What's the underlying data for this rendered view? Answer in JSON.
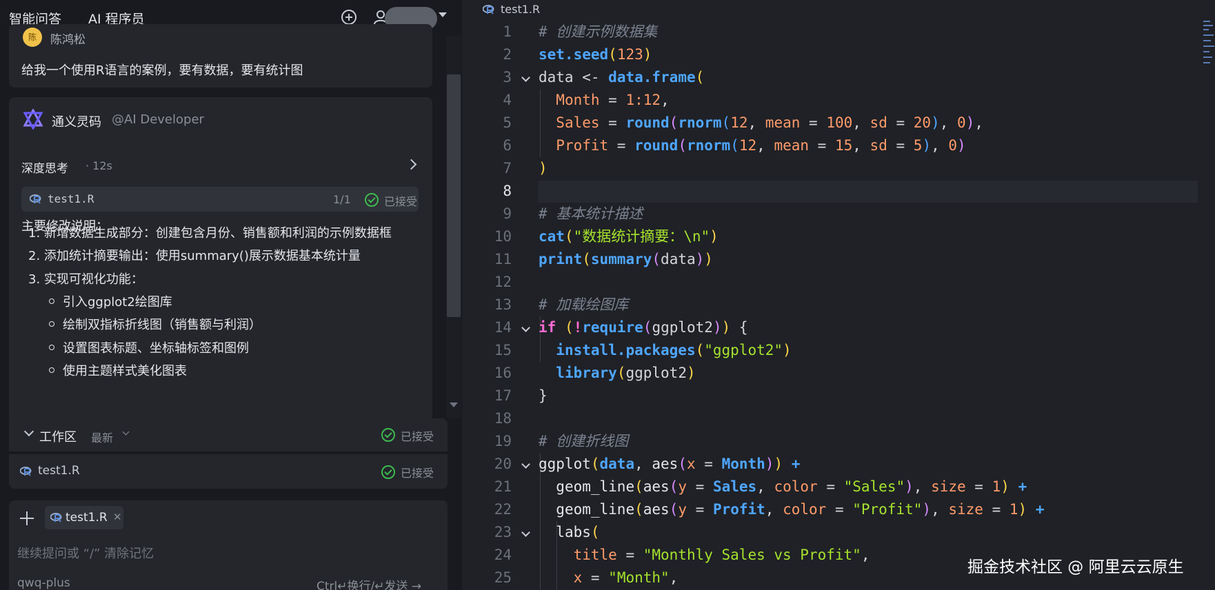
{
  "tabs": [
    "智能问答",
    "AI 程序员"
  ],
  "user_message": {
    "name": "陈鸿松",
    "text": "给我一个使用R语言的案例，要有数据，要有统计图"
  },
  "ai": {
    "name": "通义灵码",
    "handle": "@AI Developer",
    "think_label": "深度思考",
    "think_time": "· 12s",
    "file": {
      "name": "test1.R",
      "count": "1/1",
      "status": "已接受"
    },
    "summary_title": "主要修改说明：",
    "ordered": [
      "1. 新增数据生成部分：创建包含月份、销售额和利润的示例数据框",
      "2. 添加统计摘要输出：使用summary()展示数据基本统计量",
      "3. 实现可视化功能："
    ],
    "bullets": [
      "引入ggplot2绘图库",
      "绘制双指标折线图（销售额与利润）",
      "设置图表标题、坐标轴标签和图例",
      "使用主题样式美化图表"
    ]
  },
  "workspace": {
    "title": "工作区",
    "filter": "最新",
    "status": "已接受",
    "file": "test1.R",
    "file_status": "已接受"
  },
  "input": {
    "chip": "test1.R",
    "placeholder": "继续提问或 “/” 清除记忆",
    "model": "qwq-plus",
    "hint": "Ctrl↵换行/↵发送 →"
  },
  "editor": {
    "tab": "test1.R",
    "active_line": 8,
    "line_numbers": [
      "1",
      "2",
      "3",
      "4",
      "5",
      "6",
      "7",
      "8",
      "9",
      "10",
      "11",
      "12",
      "13",
      "14",
      "15",
      "16",
      "17",
      "18",
      "19",
      "20",
      "21",
      "22",
      "23",
      "24",
      "25"
    ]
  },
  "watermark": "掘金技术社区 @ 阿里云云原生",
  "colors": {
    "accent": "#4c8dff",
    "accepted": "#3fb950",
    "keyword": "#ff6bd5",
    "string": "#a6e22e"
  }
}
